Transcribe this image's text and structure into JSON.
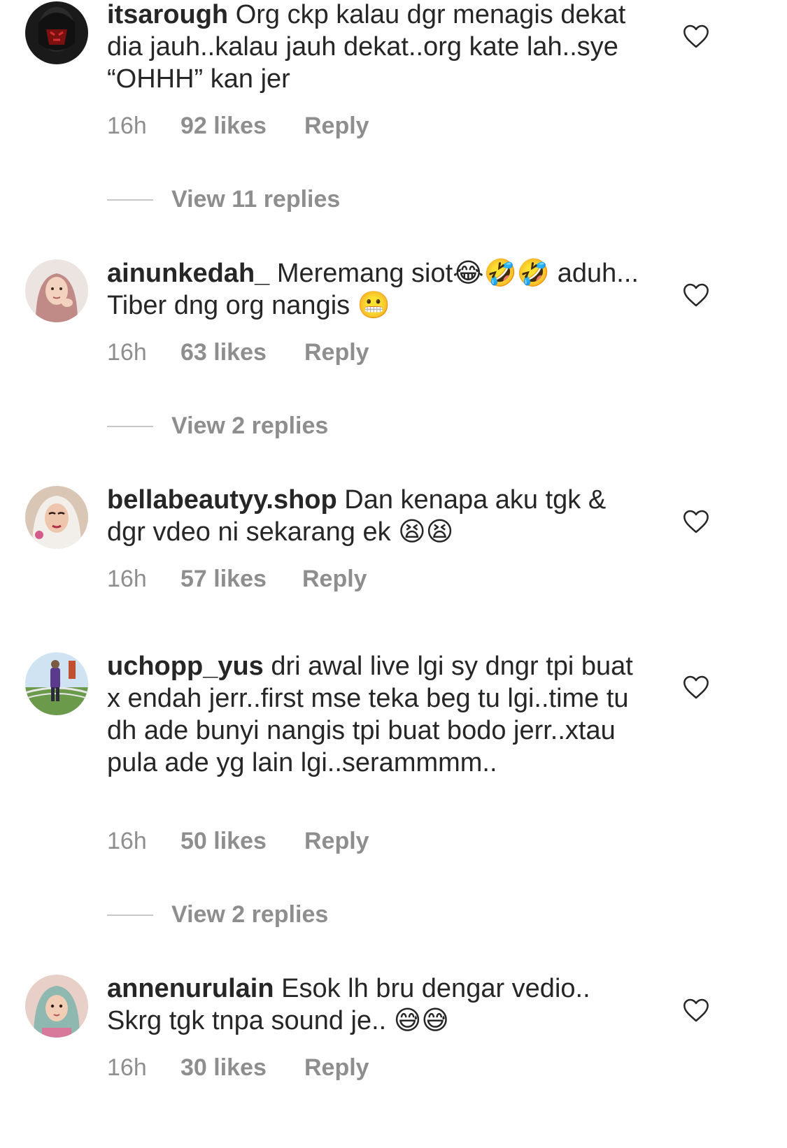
{
  "comments": [
    {
      "username": "itsarough",
      "text": "Org ckp kalau dgr menagis dekat dia jauh..kalau jauh dekat..org kate lah..sye “OHHH” kan jer",
      "time": "16h",
      "likes": "92 likes",
      "reply": "Reply",
      "view_replies": "View 11 replies",
      "avatar_icon": "avatar-masked-face"
    },
    {
      "username": "ainunkedah_",
      "text": "Meremang siot😂🤣🤣 aduh... Tiber dng org nangis 😬",
      "time": "16h",
      "likes": "63 likes",
      "reply": "Reply",
      "view_replies": "View 2 replies",
      "avatar_icon": "avatar-hijab-girl"
    },
    {
      "username": "bellabeautyy.shop",
      "text": "Dan kenapa aku tgk & dgr vdeo ni sekarang ek 😫😫",
      "time": "16h",
      "likes": "57 likes",
      "reply": "Reply",
      "avatar_icon": "avatar-white-hijab"
    },
    {
      "username": "uchopp_yus",
      "text": "dri awal live lgi sy dngr tpi buat x endah jerr..first mse teka beg tu lgi..time tu dh ade bunyi nangis tpi buat bodo jerr..xtau pula ade yg lain lgi..serammmm..",
      "time": "16h",
      "likes": "50 likes",
      "reply": "Reply",
      "view_replies": "View 2 replies",
      "avatar_icon": "avatar-outdoor-person"
    },
    {
      "username": "annenurulain",
      "text": "Esok lh bru dengar vedio.. Skrg tgk tnpa sound je.. 😅😅",
      "time": "16h",
      "likes": "30 likes",
      "reply": "Reply",
      "avatar_icon": "avatar-child-hijab"
    }
  ],
  "like_icon": "heart-outline-icon",
  "colors": {
    "text": "#262626",
    "meta": "#8e8e8e",
    "divider": "#c7c7c7",
    "background": "#ffffff"
  }
}
